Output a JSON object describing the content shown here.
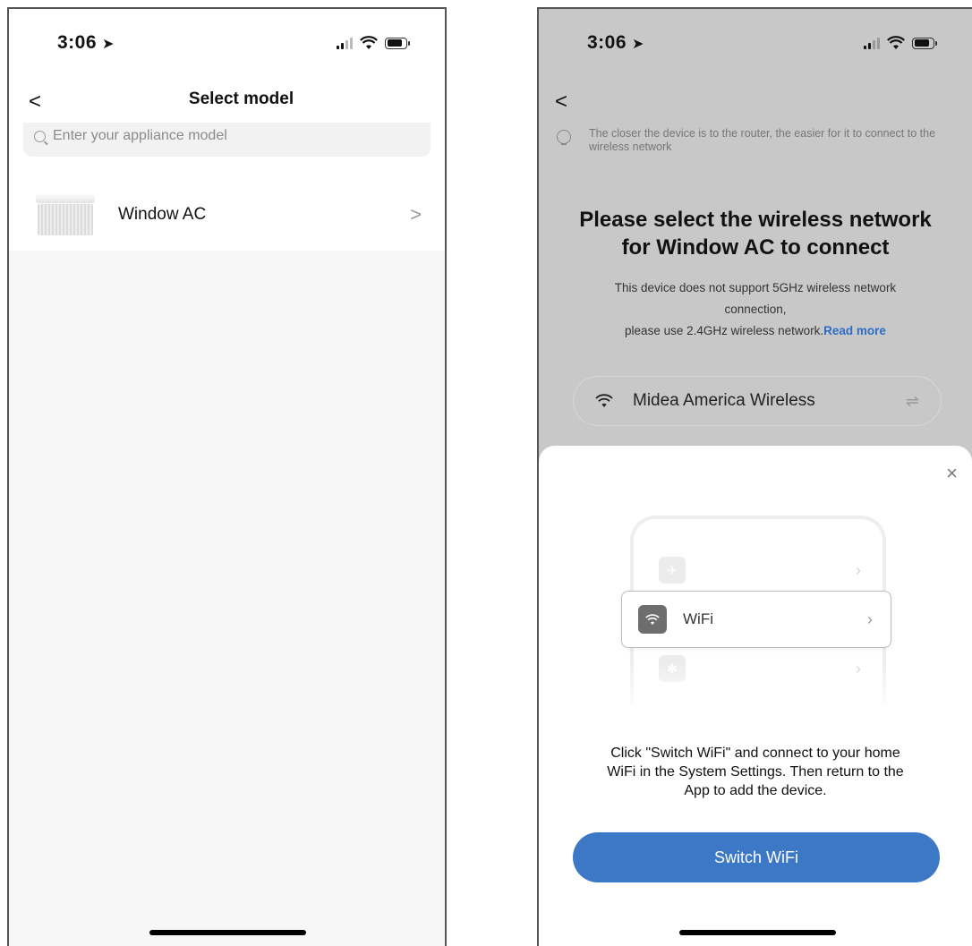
{
  "left_screen": {
    "status": {
      "time": "3:06"
    },
    "nav": {
      "title": "Select model",
      "back": "<"
    },
    "search": {
      "placeholder": "Enter your appliance model"
    },
    "models": [
      {
        "name": "Window AC",
        "chevron": ">"
      }
    ]
  },
  "right_screen": {
    "status": {
      "time": "3:06"
    },
    "nav": {
      "back": "<"
    },
    "tip": "The closer the device is to the router, the easier for it to connect to the wireless network",
    "title_line1": "Please select the wireless network",
    "title_line2": "for Window AC to connect",
    "desc_line1": "This device does not support 5GHz wireless network",
    "desc_line2": "connection,",
    "desc_line3": "please use 2.4GHz wireless network.",
    "read_more": "Read more",
    "network": {
      "name": "Midea America Wireless",
      "swap_icon": "⇌"
    },
    "sheet": {
      "close": "×",
      "illustration": {
        "wifi_label": "WiFi",
        "rows": [
          "airplane-icon",
          "wifi-icon",
          "bluetooth-icon"
        ]
      },
      "instruction_line1": "Click \"Switch WiFi\" and connect to your home",
      "instruction_line2": "WiFi in the System Settings. Then return to the",
      "instruction_line3": "App to add the device.",
      "button": "Switch WiFi"
    }
  },
  "colors": {
    "accent": "#3d78c7",
    "link": "#2d6cc7",
    "overlay": "#c8c8c8"
  }
}
